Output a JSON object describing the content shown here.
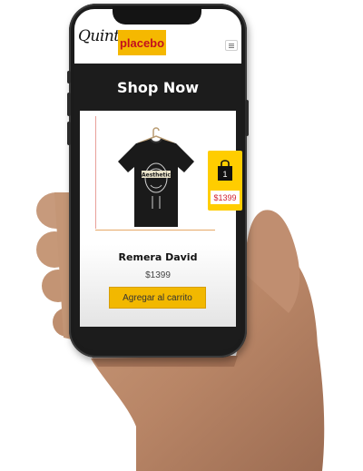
{
  "brand": {
    "script_text": "Quinto",
    "box_text": "placebo",
    "accent_yellow": "#f5b800",
    "accent_red": "#c3101e"
  },
  "header": {
    "menu_icon": "hamburger-icon"
  },
  "band": {
    "title": "Shop Now"
  },
  "product": {
    "name": "Remera David",
    "price": "$1399",
    "shirt_print": "Aesthetic",
    "add_to_cart_label": "Agregar al carrito"
  },
  "cart": {
    "count": "1",
    "total": "$1399",
    "icon": "shopping-bag-icon"
  }
}
